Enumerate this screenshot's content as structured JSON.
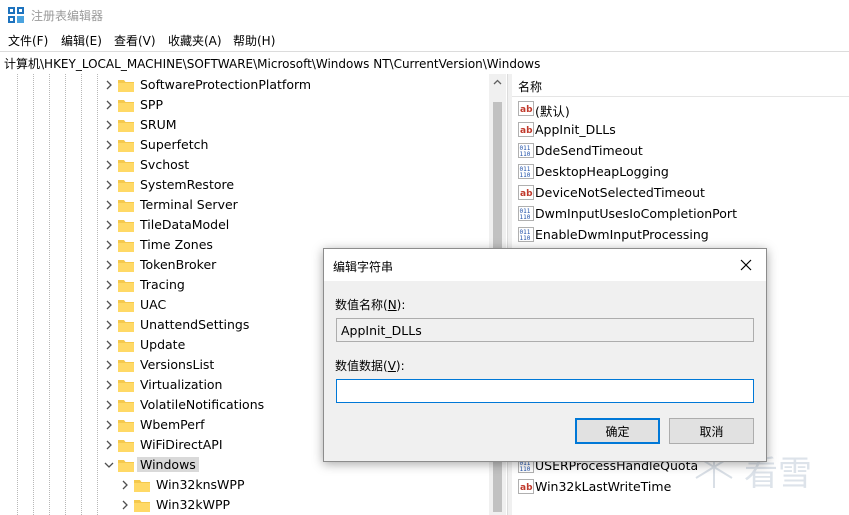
{
  "window": {
    "title": "注册表编辑器"
  },
  "menu": [
    "文件(F)",
    "编辑(E)",
    "查看(V)",
    "收藏夹(A)",
    "帮助(H)"
  ],
  "address": "计算机\\HKEY_LOCAL_MACHINE\\SOFTWARE\\Microsoft\\Windows NT\\CurrentVersion\\Windows",
  "tree": {
    "items": [
      "SoftwareProtectionPlatform",
      "SPP",
      "SRUM",
      "Superfetch",
      "Svchost",
      "SystemRestore",
      "Terminal Server",
      "TileDataModel",
      "Time Zones",
      "TokenBroker",
      "Tracing",
      "UAC",
      "UnattendSettings",
      "Update",
      "VersionsList",
      "Virtualization",
      "VolatileNotifications",
      "WbemPerf",
      "WiFiDirectAPI",
      "Windows"
    ],
    "selected": "Windows",
    "children": [
      "Win32knsWPP",
      "Win32kWPP"
    ]
  },
  "values": {
    "header": "名称",
    "items": [
      {
        "name": "(默认)",
        "type": "string"
      },
      {
        "name": "AppInit_DLLs",
        "type": "string"
      },
      {
        "name": "DdeSendTimeout",
        "type": "binary"
      },
      {
        "name": "DesktopHeapLogging",
        "type": "binary"
      },
      {
        "name": "DeviceNotSelectedTimeout",
        "type": "string"
      },
      {
        "name": "DwmInputUsesIoCompletionPort",
        "type": "binary"
      },
      {
        "name": "EnableDwmInputProcessing",
        "type": "binary"
      },
      {
        "name": "USERProcessHandleQuota",
        "type": "binary"
      },
      {
        "name": "Win32kLastWriteTime",
        "type": "string"
      }
    ]
  },
  "dialog": {
    "title": "编辑字符串",
    "name_label": "数值名称(",
    "name_key": "N",
    "name_label_end": "):",
    "name_value": "AppInit_DLLs",
    "data_label": "数值数据(",
    "data_key": "V",
    "data_label_end": "):",
    "data_value": "",
    "ok_label": "确定",
    "cancel_label": "取消"
  },
  "watermark": {
    "text": "看雪"
  }
}
